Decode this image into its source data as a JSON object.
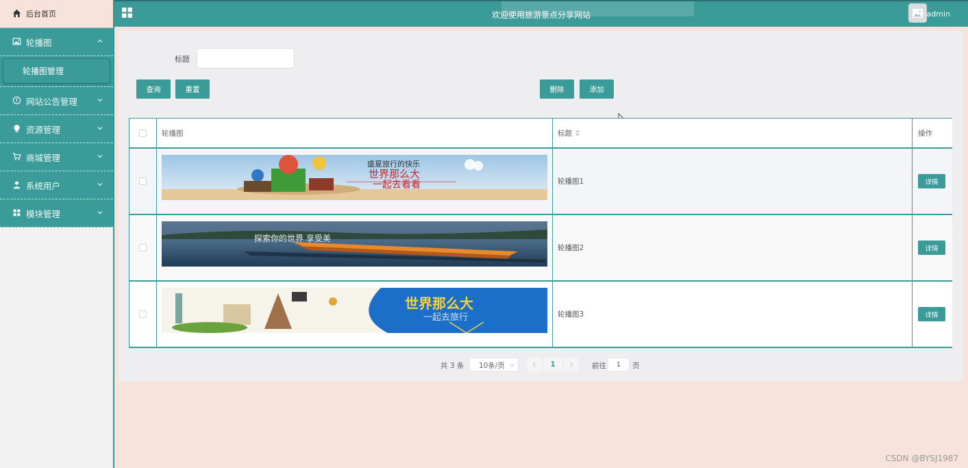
{
  "app": {
    "title": "欢迎使用旅游景点分享网站",
    "username": "admin"
  },
  "sidebar": {
    "home": "后台首页",
    "groups": [
      {
        "label": "轮播图",
        "icon": "image-icon",
        "expanded": true,
        "children": [
          "轮播图管理"
        ]
      },
      {
        "label": "网站公告管理",
        "icon": "info-icon"
      },
      {
        "label": "资源管理",
        "icon": "bulb-icon"
      },
      {
        "label": "商城管理",
        "icon": "cart-icon"
      },
      {
        "label": "系统用户",
        "icon": "user-icon"
      },
      {
        "label": "模块管理",
        "icon": "grid-icon"
      }
    ]
  },
  "search": {
    "label": "标题",
    "value": "",
    "placeholder": ""
  },
  "toolbar": {
    "query": "查询",
    "reset": "重置",
    "delete": "删除",
    "add": "添加"
  },
  "table": {
    "columns": [
      "轮播图",
      "标题",
      "操作"
    ],
    "rows": [
      {
        "title": "轮播图1",
        "action": "详情",
        "banner_text": [
          "盛夏旅行的快乐",
          "世界那么大",
          "一起去看看"
        ]
      },
      {
        "title": "轮播图2",
        "action": "详情",
        "banner_text": [
          "探索你的世界 享受美"
        ]
      },
      {
        "title": "轮播图3",
        "action": "详情",
        "banner_text": [
          "世界那么大",
          "一起去旅行"
        ]
      }
    ]
  },
  "pagination": {
    "total": "共 3 条",
    "page_size": "10条/页",
    "current_page": "1",
    "goto_label": "前往",
    "goto_value": "1",
    "goto_suffix": "页"
  },
  "watermark": "CSDN @BYSJ1987",
  "colors": {
    "accent": "#3a9b99",
    "background": "#f7e3dc",
    "panel": "#eeeef0"
  }
}
